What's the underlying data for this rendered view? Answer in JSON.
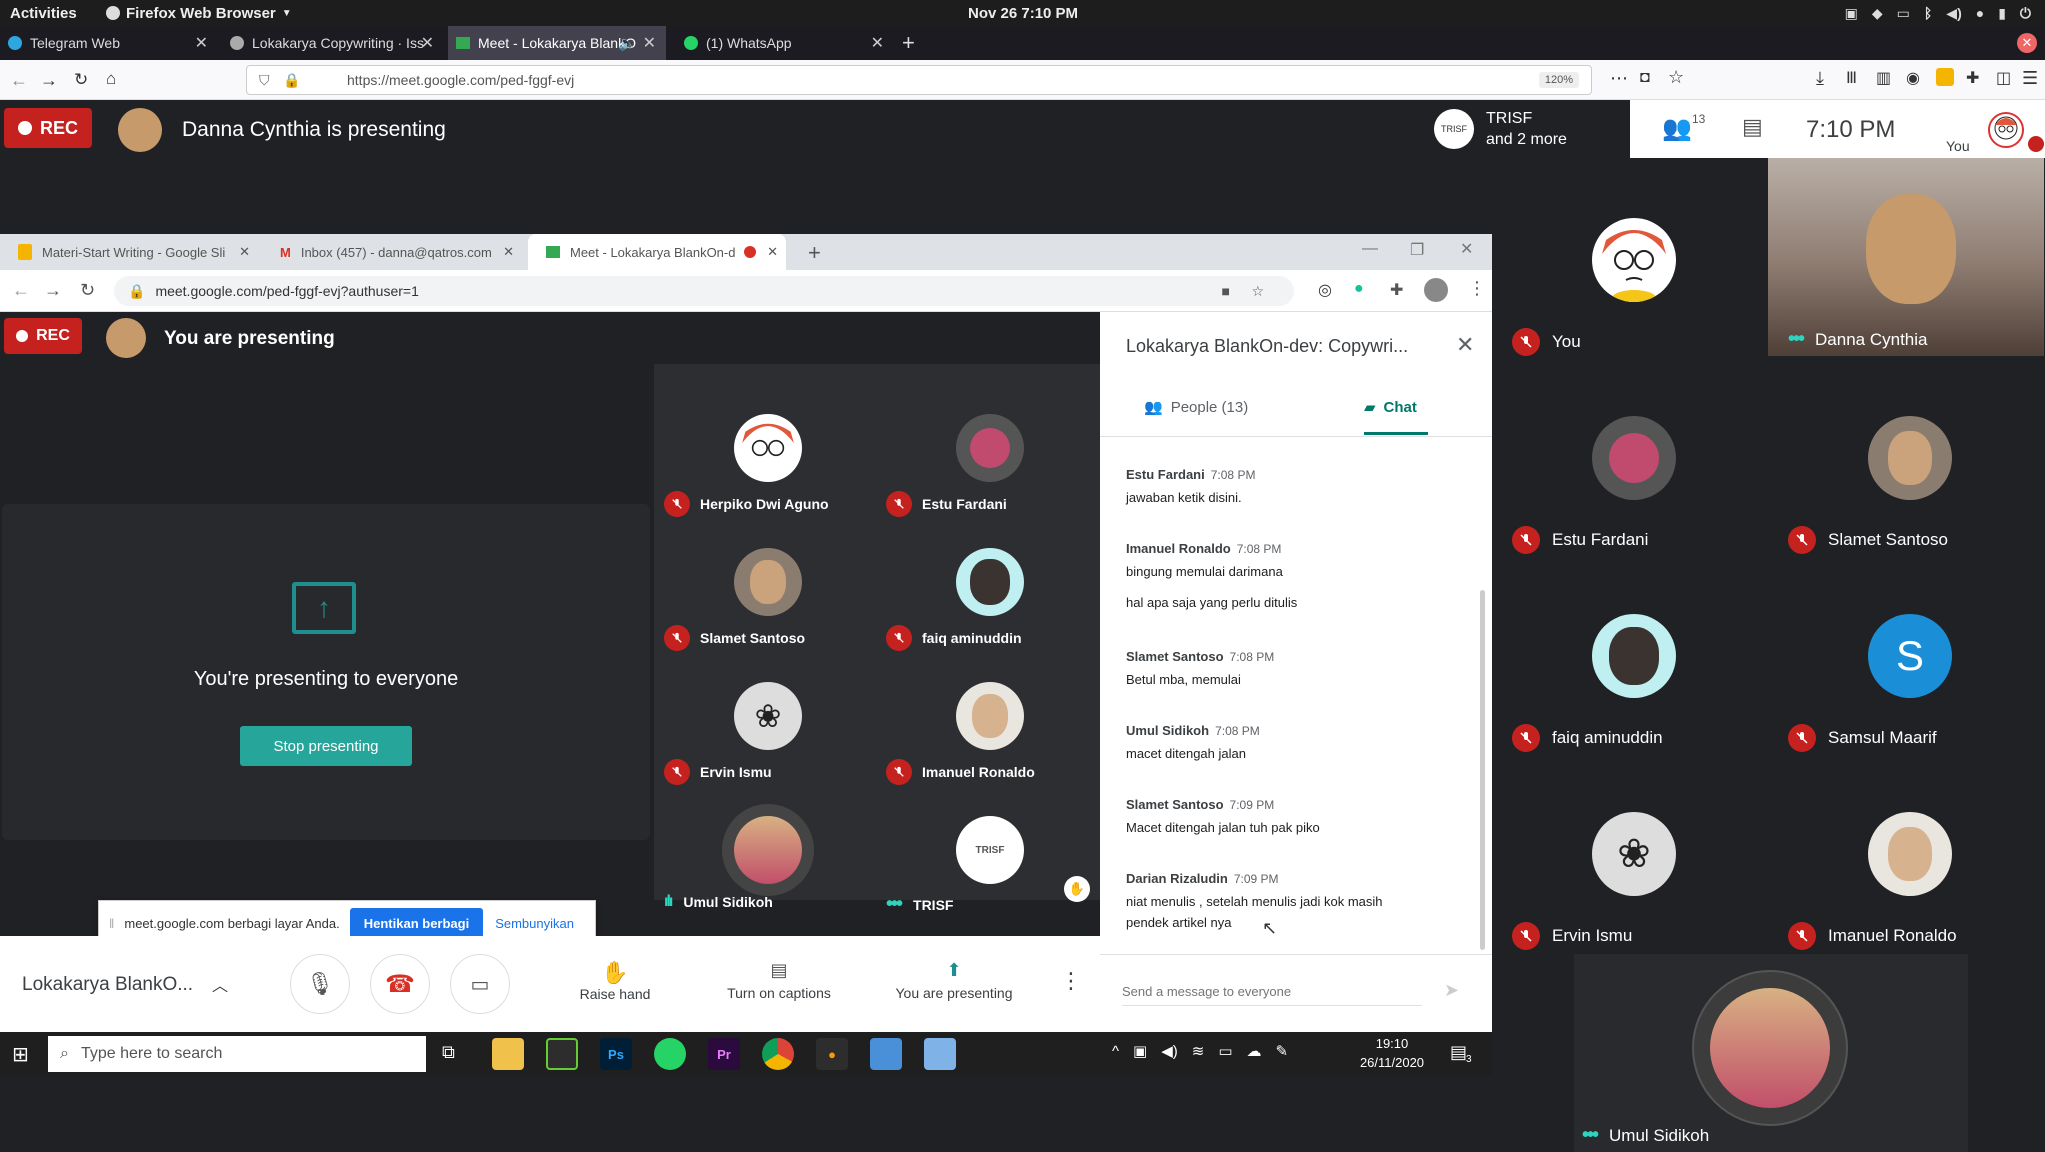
{
  "gnome": {
    "activities": "Activities",
    "app": "Firefox Web Browser",
    "datetime": "Nov 26  7:10 PM"
  },
  "firefox": {
    "tabs": [
      {
        "label": "Telegram Web"
      },
      {
        "label": "Lokakarya Copywriting · Iss"
      },
      {
        "label": "Meet - Lokakarya BlankO"
      },
      {
        "label": "(1) WhatsApp"
      }
    ],
    "url": "https://meet.google.com/ped-fggf-evj",
    "zoom": "120%"
  },
  "meet": {
    "rec": "REC",
    "presenting": "Danna Cynthia is presenting",
    "trisf_line1": "TRISF",
    "trisf_line2": "and 2 more",
    "people_count": "13",
    "clock": "7:10 PM",
    "you": "You",
    "participants": [
      {
        "name": "You",
        "status": "muted"
      },
      {
        "name": "Danna Cynthia",
        "status": "speaking"
      },
      {
        "name": "Estu Fardani",
        "status": "muted"
      },
      {
        "name": "Slamet Santoso",
        "status": "muted"
      },
      {
        "name": "faiq aminuddin",
        "status": "muted"
      },
      {
        "name": "Samsul Maarif",
        "status": "muted",
        "initial": "S"
      },
      {
        "name": "Ervin Ismu",
        "status": "muted"
      },
      {
        "name": "Imanuel Ronaldo",
        "status": "muted"
      },
      {
        "name": "Umul Sidikoh",
        "status": "speaking"
      }
    ]
  },
  "shared": {
    "tabs": [
      {
        "label": "Materi-Start Writing - Google Sli"
      },
      {
        "label": "Inbox (457) - danna@qatros.com"
      },
      {
        "label": "Meet - Lokakarya BlankOn-d"
      }
    ],
    "url": "meet.google.com/ped-fggf-evj?authuser=1",
    "rec": "REC",
    "you_presenting": "You are presenting",
    "presenting_everyone": "You're presenting to everyone",
    "stop_presenting": "Stop presenting",
    "grid": [
      {
        "name": "Herpiko Dwi Aguno",
        "status": "muted"
      },
      {
        "name": "Estu Fardani",
        "status": "muted"
      },
      {
        "name": "Slamet Santoso",
        "status": "muted"
      },
      {
        "name": "faiq aminuddin",
        "status": "muted"
      },
      {
        "name": "Ervin Ismu",
        "status": "muted"
      },
      {
        "name": "Imanuel Ronaldo",
        "status": "muted"
      },
      {
        "name": "Umul Sidikoh",
        "status": "speaking"
      },
      {
        "name": "TRISF",
        "status": "dots"
      }
    ],
    "share_bar": {
      "text": "meet.google.com berbagi layar Anda.",
      "stop": "Hentikan berbagi",
      "hide": "Sembunyikan"
    },
    "controls": {
      "meeting_name": "Lokakarya BlankO...",
      "raise_hand": "Raise hand",
      "captions": "Turn on captions",
      "presenting": "You are presenting"
    },
    "chat": {
      "title": "Lokakarya BlankOn-dev: Copywri...",
      "people_tab": "People (13)",
      "chat_tab": "Chat",
      "messages": [
        {
          "who": "Estu Fardani",
          "time": "7:08 PM",
          "lines": [
            "jawaban ketik disini."
          ]
        },
        {
          "who": "Imanuel Ronaldo",
          "time": "7:08 PM",
          "lines": [
            "bingung memulai darimana",
            "hal apa saja yang perlu ditulis"
          ]
        },
        {
          "who": "Slamet Santoso",
          "time": "7:08 PM",
          "lines": [
            "Betul mba, memulai"
          ]
        },
        {
          "who": "Umul Sidikoh",
          "time": "7:08 PM",
          "lines": [
            "macet ditengah jalan"
          ]
        },
        {
          "who": "Slamet Santoso",
          "time": "7:09 PM",
          "lines": [
            "Macet ditengah jalan tuh pak piko"
          ]
        },
        {
          "who": "Darian Rizaludin",
          "time": "7:09 PM",
          "lines": [
            "niat menulis , setelah menulis jadi kok masih",
            "pendek artikel nya"
          ]
        }
      ],
      "placeholder": "Send a message to everyone"
    },
    "taskbar": {
      "search": "Type here to search",
      "time": "19:10",
      "date": "26/11/2020",
      "notif": "3"
    }
  },
  "colors": {
    "rec": "#c5221f",
    "teal": "#1e8e8e",
    "blue": "#1a73e8",
    "dots": "#2dd4bf"
  }
}
